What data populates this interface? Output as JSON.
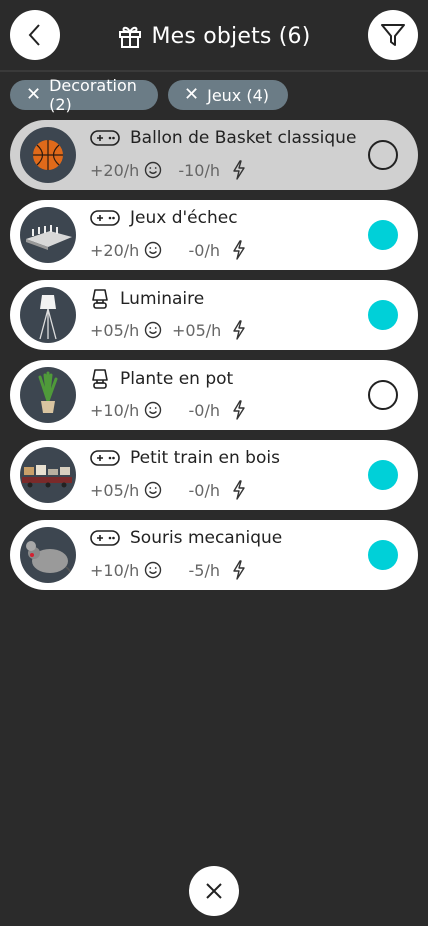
{
  "header": {
    "title": "Mes objets (6)",
    "back_icon": "chevron-left-icon",
    "title_icon": "gift-icon",
    "filter_icon": "filter-icon"
  },
  "filters": [
    {
      "label": "Decoration (2)"
    },
    {
      "label": "Jeux (4)"
    }
  ],
  "items": [
    {
      "name": "Ballon de Basket classique",
      "type_icon": "gamepad-icon",
      "happiness": "+20/h",
      "energy": "-10/h",
      "selected": true,
      "active": false,
      "thumb": "basketball"
    },
    {
      "name": "Jeux d'échec",
      "type_icon": "gamepad-icon",
      "happiness": "+20/h",
      "energy": "-0/h",
      "selected": false,
      "active": true,
      "thumb": "chess"
    },
    {
      "name": "Luminaire",
      "type_icon": "lamp-icon",
      "happiness": "+05/h",
      "energy": "+05/h",
      "selected": false,
      "active": true,
      "thumb": "lamp"
    },
    {
      "name": "Plante en pot",
      "type_icon": "lamp-icon",
      "happiness": "+10/h",
      "energy": "-0/h",
      "selected": false,
      "active": false,
      "thumb": "plant"
    },
    {
      "name": "Petit train en bois",
      "type_icon": "gamepad-icon",
      "happiness": "+05/h",
      "energy": "-0/h",
      "selected": false,
      "active": true,
      "thumb": "train"
    },
    {
      "name": "Souris mecanique",
      "type_icon": "gamepad-icon",
      "happiness": "+10/h",
      "energy": "-5/h",
      "selected": false,
      "active": true,
      "thumb": "mouse"
    }
  ],
  "colors": {
    "accent": "#00d0d8",
    "background": "#2b2b2b",
    "chip": "#6b7c86"
  }
}
